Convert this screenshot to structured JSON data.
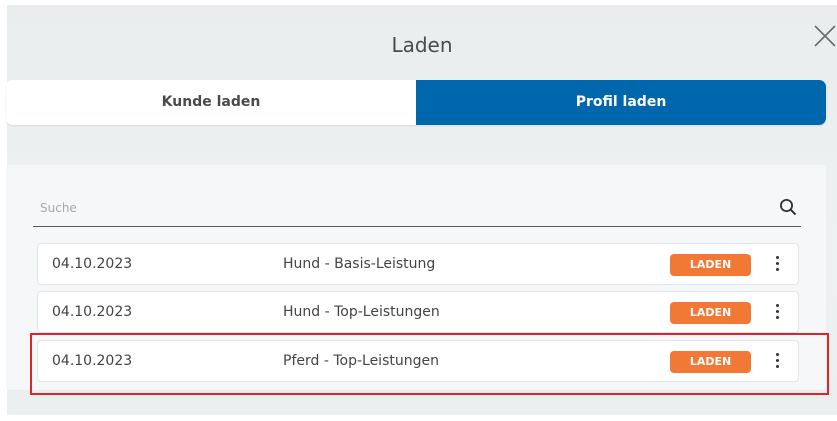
{
  "dialog": {
    "title": "Laden",
    "close_icon": "close-icon"
  },
  "tabs": [
    {
      "label": "Kunde laden",
      "active": false
    },
    {
      "label": "Profil laden",
      "active": true
    }
  ],
  "search": {
    "placeholder": "Suche",
    "value": "",
    "icon": "search-icon"
  },
  "rows": [
    {
      "date": "04.10.2023",
      "name": "Hund - Basis-Leistung",
      "button": "LADEN",
      "menu_icon": "more-vertical-icon"
    },
    {
      "date": "04.10.2023",
      "name": "Hund - Top-Leistungen",
      "button": "LADEN",
      "menu_icon": "more-vertical-icon"
    },
    {
      "date": "04.10.2023",
      "name": "Pferd - Top-Leistungen",
      "button": "LADEN",
      "menu_icon": "more-vertical-icon",
      "highlighted": true
    }
  ],
  "colors": {
    "active_tab": "#0067ad",
    "load_button": "#f27935",
    "highlight_border": "#e0232a"
  }
}
